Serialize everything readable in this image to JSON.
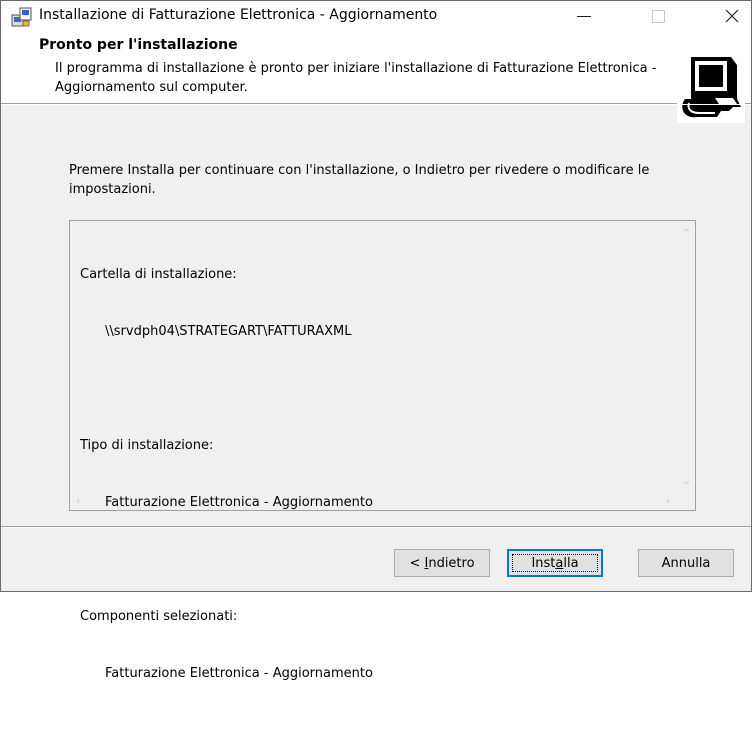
{
  "window": {
    "title": "Installazione di Fatturazione Elettronica - Aggiornamento",
    "icons": {
      "app": "installer-icon",
      "minimize": "minimize-icon",
      "maximize": "maximize-icon",
      "close": "close-icon"
    }
  },
  "header": {
    "title": "Pronto per l'installazione",
    "description": "Il programma di installazione è pronto per iniziare l'installazione di Fatturazione Elettronica - Aggiornamento sul computer.",
    "image_icon": "computer-install-icon"
  },
  "main": {
    "intro": "Premere Installa per continuare con l'installazione, o Indietro per rivedere o modificare le impostazioni.",
    "summary": [
      {
        "label": "Cartella di installazione:",
        "value": "\\\\srvdph04\\STRATEGART\\FATTURAXML"
      },
      {
        "label": "Tipo di installazione:",
        "value": "Fatturazione Elettronica - Aggiornamento"
      },
      {
        "label": "Componenti selezionati:",
        "value": "Fatturazione Elettronica - Aggiornamento"
      }
    ]
  },
  "buttons": {
    "back": {
      "prefix": "< ",
      "mnemonic": "I",
      "rest": "ndietro"
    },
    "install": {
      "before": "Inst",
      "mnemonic": "a",
      "after": "lla"
    },
    "cancel": "Annulla"
  },
  "colors": {
    "focus_border": "#0078d7",
    "button_face": "#e1e1e1",
    "dialog_bg": "#f0f0f0"
  }
}
